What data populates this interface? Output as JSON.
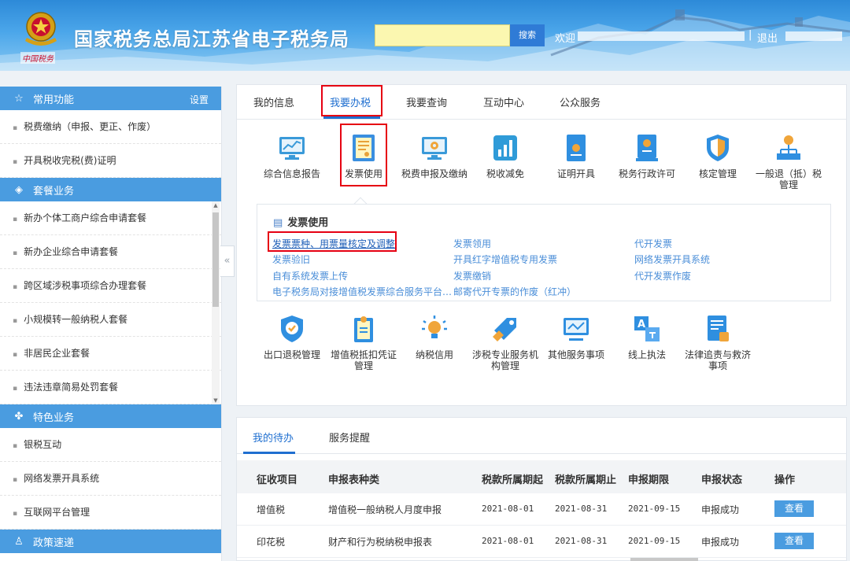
{
  "header": {
    "site_title": "国家税务总局江苏省电子税务局",
    "emblem_text": "中国税务",
    "search_placeholder": "",
    "search_button": "搜索",
    "welcome": "欢迎",
    "separator": "|",
    "logout": "退出"
  },
  "sidebar": {
    "common": {
      "title": "常用功能",
      "setting": "设置",
      "items": [
        "税费缴纳（申报、更正、作废）",
        "开具税收完税(费)证明"
      ]
    },
    "package": {
      "title": "套餐业务",
      "items": [
        "新办个体工商户综合申请套餐",
        "新办企业综合申请套餐",
        "跨区域涉税事项综合办理套餐",
        "小规模转一般纳税人套餐",
        "非居民企业套餐",
        "违法违章简易处罚套餐"
      ]
    },
    "special": {
      "title": "特色业务",
      "items": [
        "银税互动",
        "网络发票开具系统",
        "互联网平台管理"
      ]
    },
    "policy": {
      "title": "政策速递"
    },
    "collapse_glyph": "«"
  },
  "main": {
    "tabs": [
      "我的信息",
      "我要办税",
      "我要查询",
      "互动中心",
      "公众服务"
    ],
    "active_tab": 1,
    "icons_row1": [
      "综合信息报告",
      "发票使用",
      "税费申报及缴纳",
      "税收减免",
      "证明开具",
      "税务行政许可",
      "核定管理",
      "一般退（抵）税管理"
    ],
    "icons_row2": [
      "出口退税管理",
      "增值税抵扣凭证管理",
      "纳税信用",
      "涉税专业服务机构管理",
      "其他服务事项",
      "线上执法",
      "法律追责与救济事项"
    ],
    "subpanel": {
      "title": "发票使用",
      "links": [
        "发票票种、用票量核定及调整",
        "发票领用",
        "代开发票",
        "发票验旧",
        "开具红字增值税专用发票",
        "网络发票开具系统",
        "自有系统发票上传",
        "发票缴销",
        "代开发票作废",
        "电子税务局对接增值税发票综合服务平台…",
        "邮寄代开专票的作废（红冲）"
      ]
    }
  },
  "todo": {
    "tabs": [
      "我的待办",
      "服务提醒"
    ],
    "columns": [
      "征收项目",
      "申报表种类",
      "税款所属期起",
      "税款所属期止",
      "申报期限",
      "申报状态",
      "操作"
    ],
    "rows": [
      {
        "item": "增值税",
        "form": "增值税一般纳税人月度申报",
        "start": "2021-08-01",
        "end": "2021-08-31",
        "deadline": "2021-09-15",
        "status": "申报成功",
        "action": "查看"
      },
      {
        "item": "印花税",
        "form": "财产和行为税纳税申报表",
        "start": "2021-08-01",
        "end": "2021-08-31",
        "deadline": "2021-09-15",
        "status": "申报成功",
        "action": "查看"
      }
    ]
  },
  "colors": {
    "accent": "#1f6fd0",
    "sidebar_head": "#4a9ce0",
    "highlight": "#e60012",
    "link": "#4a8ed8"
  }
}
